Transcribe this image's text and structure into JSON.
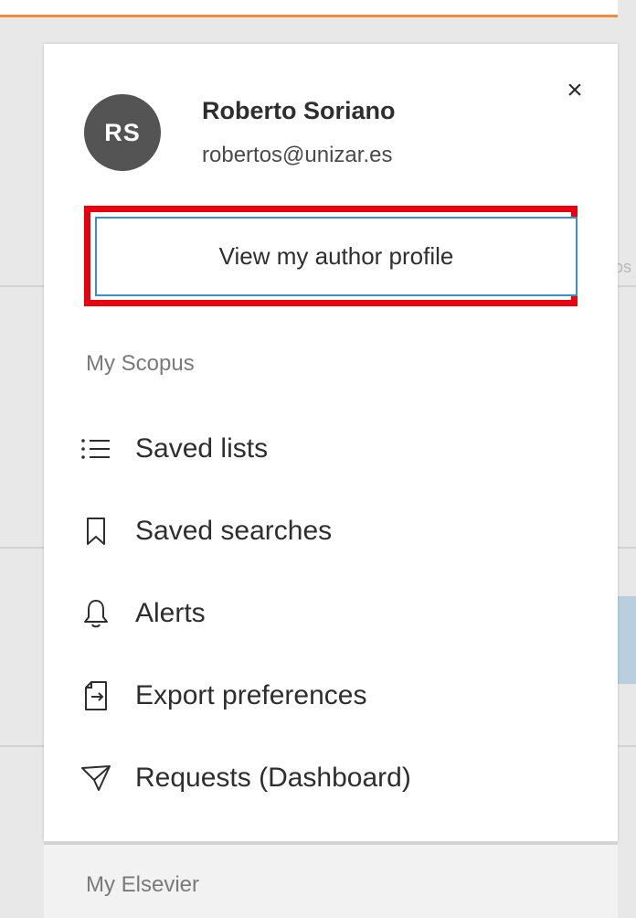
{
  "user": {
    "initials": "RS",
    "name": "Roberto Soriano",
    "email": "robertos@unizar.es"
  },
  "close_label": "×",
  "profile_button_label": "View my author profile",
  "sections": {
    "my_scopus": "My Scopus",
    "my_elsevier": "My Elsevier"
  },
  "menu": [
    {
      "label": "Saved lists",
      "icon": "list-icon"
    },
    {
      "label": "Saved searches",
      "icon": "bookmark-icon"
    },
    {
      "label": "Alerts",
      "icon": "bell-icon"
    },
    {
      "label": "Export preferences",
      "icon": "export-icon"
    },
    {
      "label": "Requests (Dashboard)",
      "icon": "paper-plane-icon"
    }
  ],
  "colors": {
    "accent_orange": "#f08b3a",
    "highlight_red": "#e8000e",
    "button_border_blue": "#3b8ec9",
    "avatar_bg": "#545454"
  }
}
